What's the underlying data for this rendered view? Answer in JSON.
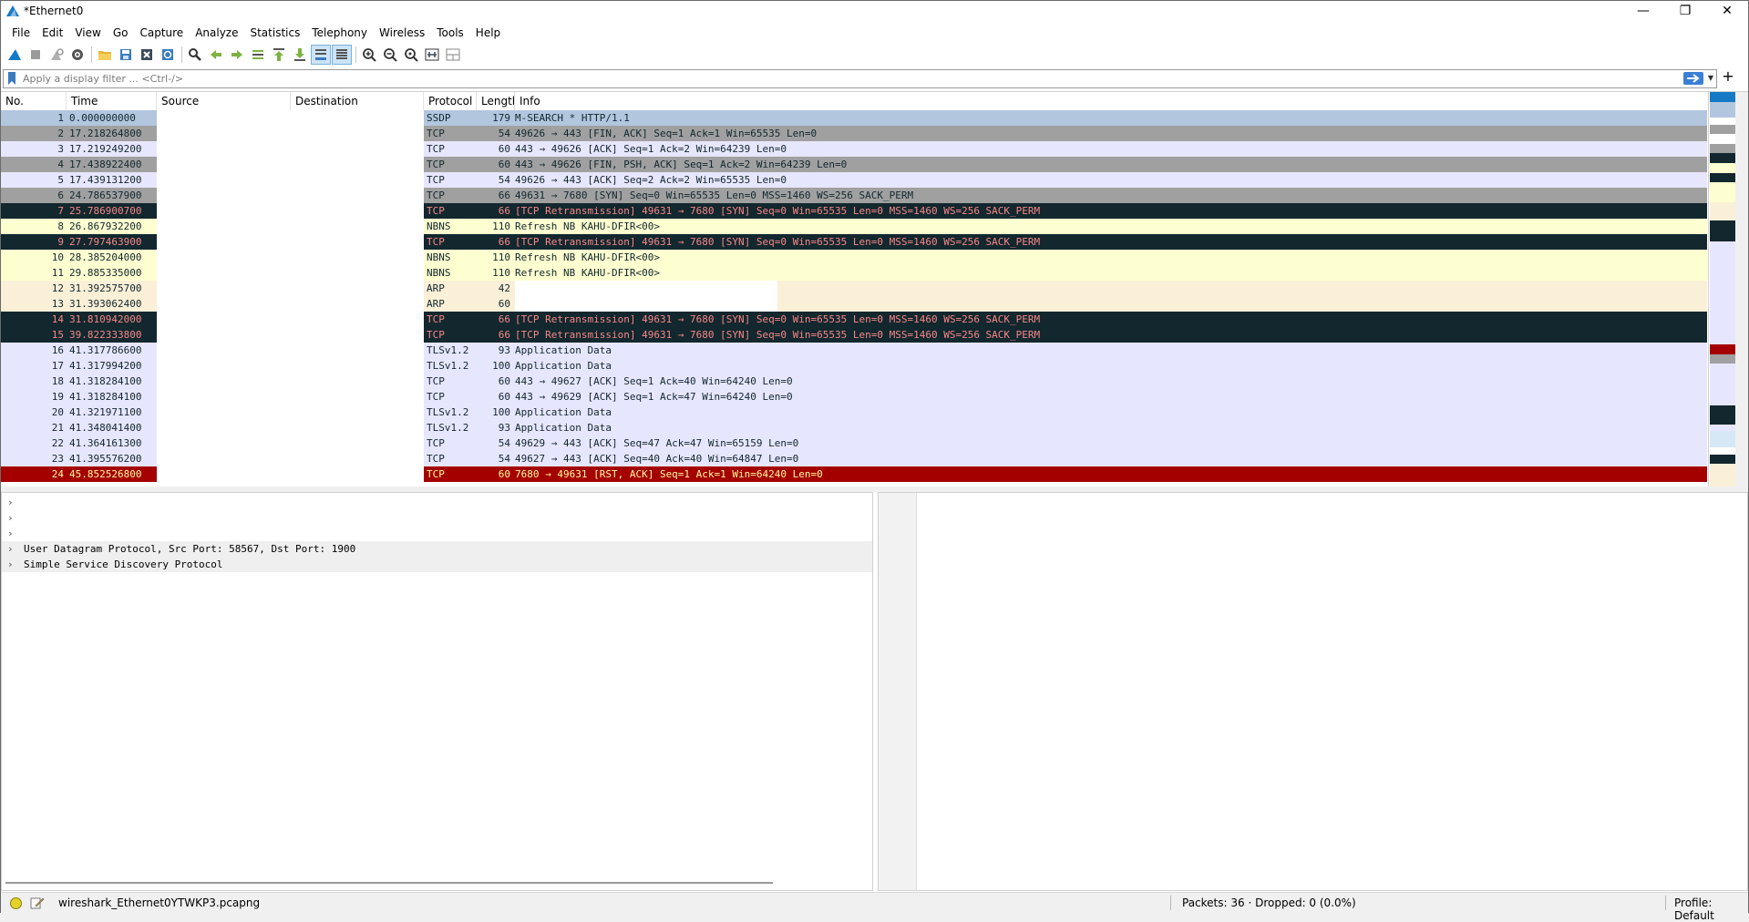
{
  "window": {
    "title": "*Ethernet0",
    "controls": {
      "minimize": "—",
      "maximize": "❐",
      "close": "✕"
    }
  },
  "menu": [
    "File",
    "Edit",
    "View",
    "Go",
    "Capture",
    "Analyze",
    "Statistics",
    "Telephony",
    "Wireless",
    "Tools",
    "Help"
  ],
  "toolbar": [
    "shark-fin-start-icon",
    "stop-square-icon",
    "restart-capture-icon",
    "capture-options-gear-icon",
    "open-folder-icon",
    "save-file-icon",
    "close-file-icon",
    "reload-file-icon",
    "find-packet-icon",
    "go-back-arrow-icon",
    "go-forward-arrow-icon",
    "go-to-packet-icon",
    "go-first-packet-icon",
    "go-last-packet-icon",
    "autoscroll-icon",
    "colorize-icon",
    "zoom-in-icon",
    "zoom-out-icon",
    "zoom-normal-icon",
    "resize-columns-icon",
    "layout-icon"
  ],
  "filter": {
    "placeholder": "Apply a display filter ... <Ctrl-/>",
    "value": ""
  },
  "packet_list": {
    "columns": [
      "No.",
      "Time",
      "Source",
      "Destination",
      "Protocol",
      "Lengtl",
      "Info"
    ],
    "rows": [
      {
        "no": "1",
        "time": "0.000000000",
        "protocol": "SSDP",
        "length": "179",
        "info": "M-SEARCH * HTTP/1.1",
        "bg": "#b2c6de",
        "fg": "#12272e"
      },
      {
        "no": "2",
        "time": "17.218264800",
        "protocol": "TCP",
        "length": "54",
        "info": "49626 → 443 [FIN, ACK] Seq=1 Ack=1 Win=65535 Len=0",
        "bg": "#a0a0a0",
        "fg": "#12272e"
      },
      {
        "no": "3",
        "time": "17.219249200",
        "protocol": "TCP",
        "length": "60",
        "info": "443 → 49626 [ACK] Seq=1 Ack=2 Win=64239 Len=0",
        "bg": "#e7e6ff",
        "fg": "#12272e"
      },
      {
        "no": "4",
        "time": "17.438922400",
        "protocol": "TCP",
        "length": "60",
        "info": "443 → 49626 [FIN, PSH, ACK] Seq=1 Ack=2 Win=64239 Len=0",
        "bg": "#a0a0a0",
        "fg": "#12272e"
      },
      {
        "no": "5",
        "time": "17.439131200",
        "protocol": "TCP",
        "length": "54",
        "info": "49626 → 443 [ACK] Seq=2 Ack=2 Win=65535 Len=0",
        "bg": "#e7e6ff",
        "fg": "#12272e"
      },
      {
        "no": "6",
        "time": "24.786537900",
        "protocol": "TCP",
        "length": "66",
        "info": "49631 → 7680 [SYN] Seq=0 Win=65535 Len=0 MSS=1460 WS=256 SACK_PERM",
        "bg": "#a0a0a0",
        "fg": "#12272e"
      },
      {
        "no": "7",
        "time": "25.786900700",
        "protocol": "TCP",
        "length": "66",
        "info": "[TCP Retransmission] 49631 → 7680 [SYN] Seq=0 Win=65535 Len=0 MSS=1460 WS=256 SACK_PERM",
        "bg": "#12272e",
        "fg": "#f78787"
      },
      {
        "no": "8",
        "time": "26.867932200",
        "protocol": "NBNS",
        "length": "110",
        "info": "Refresh NB KAHU-DFIR<00>",
        "bg": "#feffd0",
        "fg": "#12272e"
      },
      {
        "no": "9",
        "time": "27.797463900",
        "protocol": "TCP",
        "length": "66",
        "info": "[TCP Retransmission] 49631 → 7680 [SYN] Seq=0 Win=65535 Len=0 MSS=1460 WS=256 SACK_PERM",
        "bg": "#12272e",
        "fg": "#f78787"
      },
      {
        "no": "10",
        "time": "28.385204000",
        "protocol": "NBNS",
        "length": "110",
        "info": "Refresh NB KAHU-DFIR<00>",
        "bg": "#feffd0",
        "fg": "#12272e"
      },
      {
        "no": "11",
        "time": "29.885335000",
        "protocol": "NBNS",
        "length": "110",
        "info": "Refresh NB KAHU-DFIR<00>",
        "bg": "#feffd0",
        "fg": "#12272e"
      },
      {
        "no": "12",
        "time": "31.392575700",
        "protocol": "ARP",
        "length": "42",
        "info": "",
        "bg": "#faf0d7",
        "fg": "#12272e"
      },
      {
        "no": "13",
        "time": "31.393062400",
        "protocol": "ARP",
        "length": "60",
        "info": "",
        "bg": "#faf0d7",
        "fg": "#12272e"
      },
      {
        "no": "14",
        "time": "31.810942000",
        "protocol": "TCP",
        "length": "66",
        "info": "[TCP Retransmission] 49631 → 7680 [SYN] Seq=0 Win=65535 Len=0 MSS=1460 WS=256 SACK_PERM",
        "bg": "#12272e",
        "fg": "#f78787"
      },
      {
        "no": "15",
        "time": "39.822333800",
        "protocol": "TCP",
        "length": "66",
        "info": "[TCP Retransmission] 49631 → 7680 [SYN] Seq=0 Win=65535 Len=0 MSS=1460 WS=256 SACK_PERM",
        "bg": "#12272e",
        "fg": "#f78787"
      },
      {
        "no": "16",
        "time": "41.317786600",
        "protocol": "TLSv1.2",
        "length": "93",
        "info": "Application Data",
        "bg": "#e7e6ff",
        "fg": "#12272e"
      },
      {
        "no": "17",
        "time": "41.317994200",
        "protocol": "TLSv1.2",
        "length": "100",
        "info": "Application Data",
        "bg": "#e7e6ff",
        "fg": "#12272e"
      },
      {
        "no": "18",
        "time": "41.318284100",
        "protocol": "TCP",
        "length": "60",
        "info": "443 → 49627 [ACK] Seq=1 Ack=40 Win=64240 Len=0",
        "bg": "#e7e6ff",
        "fg": "#12272e"
      },
      {
        "no": "19",
        "time": "41.318284100",
        "protocol": "TCP",
        "length": "60",
        "info": "443 → 49629 [ACK] Seq=1 Ack=47 Win=64240 Len=0",
        "bg": "#e7e6ff",
        "fg": "#12272e"
      },
      {
        "no": "20",
        "time": "41.321971100",
        "protocol": "TLSv1.2",
        "length": "100",
        "info": "Application Data",
        "bg": "#e7e6ff",
        "fg": "#12272e"
      },
      {
        "no": "21",
        "time": "41.348041400",
        "protocol": "TLSv1.2",
        "length": "93",
        "info": "Application Data",
        "bg": "#e7e6ff",
        "fg": "#12272e"
      },
      {
        "no": "22",
        "time": "41.364161300",
        "protocol": "TCP",
        "length": "54",
        "info": "49629 → 443 [ACK] Seq=47 Ack=47 Win=65159 Len=0",
        "bg": "#e7e6ff",
        "fg": "#12272e"
      },
      {
        "no": "23",
        "time": "41.395576200",
        "protocol": "TCP",
        "length": "54",
        "info": "49627 → 443 [ACK] Seq=40 Ack=40 Win=64847 Len=0",
        "bg": "#e7e6ff",
        "fg": "#12272e"
      },
      {
        "no": "24",
        "time": "45.852526800",
        "protocol": "TCP",
        "length": "60",
        "info": "7680 → 49631 [RST, ACK] Seq=1 Ack=1 Win=64240 Len=0",
        "bg": "#a40000",
        "fg": "#fffc9c"
      }
    ]
  },
  "packet_details": {
    "rows": [
      {
        "chevron": "›",
        "text": ""
      },
      {
        "chevron": "›",
        "text": ""
      },
      {
        "chevron": "›",
        "text": ""
      },
      {
        "chevron": "›",
        "text": "User Datagram Protocol, Src Port: 58567, Dst Port: 1900"
      },
      {
        "chevron": "›",
        "text": "Simple Service Discovery Protocol"
      }
    ]
  },
  "status": {
    "file": "wireshark_Ethernet0YTWKP3.pcapng",
    "packets": "Packets: 36 · Dropped: 0 (0.0%)",
    "profile": "Profile: Default"
  },
  "colors": {
    "ssdp": "#b2c6de",
    "tcp_gray": "#a0a0a0",
    "tcp_light": "#e7e6ff",
    "bad_tcp": "#12272e",
    "nbns": "#feffd0",
    "arp": "#faf0d7",
    "rst": "#a40000"
  }
}
